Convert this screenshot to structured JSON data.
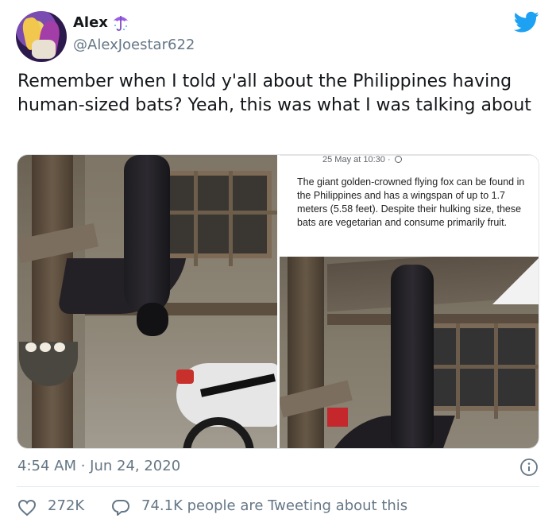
{
  "user": {
    "display_name": "Alex",
    "handle": "@AlexJoestar622",
    "name_emoji": "umbrella-icon"
  },
  "tweet": {
    "text": "Remember when I told y'all about the Philippines having human-sized bats? Yeah, this was what I was talking about",
    "timestamp": "4:54 AM · Jun 24, 2020"
  },
  "media": {
    "screenshot_time": "25 May at 10:30 ·",
    "screenshot_text": "The giant golden-crowned flying fox can be found in the Philippines and has a wingspan of up to 1.7 meters (5.58 feet). Despite their hulking size, these bats are vegetarian and consume primarily fruit."
  },
  "stats": {
    "likes": "272K",
    "tweeting": "74.1K people are Tweeting about this"
  },
  "colors": {
    "twitter_blue": "#1da1f2",
    "secondary_text": "#657786",
    "divider": "#e1e8ed"
  }
}
